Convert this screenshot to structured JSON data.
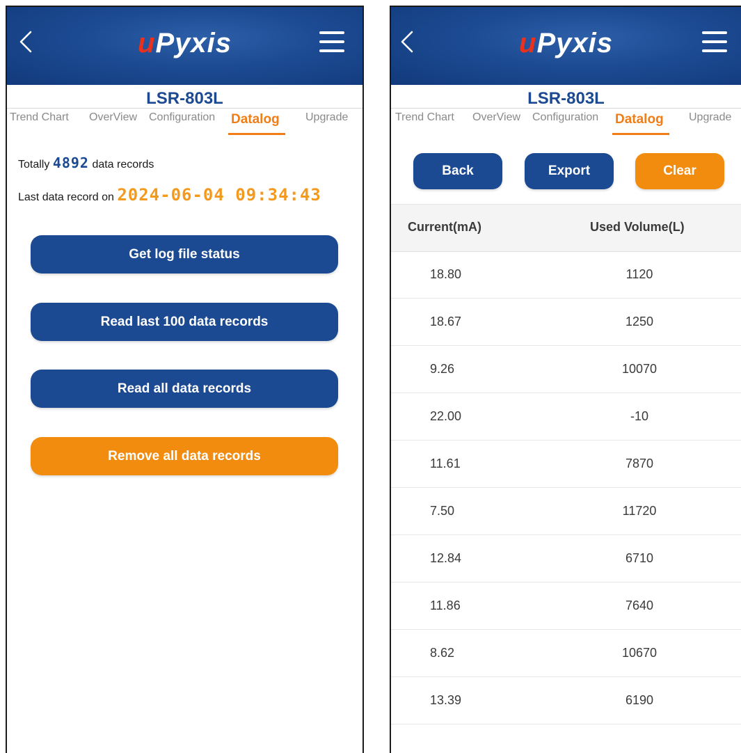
{
  "app": {
    "logo_u": "u",
    "logo_rest": "Pyxis",
    "device_title": "LSR-803L"
  },
  "tabs": [
    "Trend Chart",
    "OverView",
    "Configuration",
    "Datalog",
    "Upgrade"
  ],
  "active_tab": "Datalog",
  "status_screen": {
    "totally_prefix": "Totally",
    "record_count": "4892",
    "totally_suffix": "data records",
    "last_record_prefix": "Last data record on",
    "last_record_datetime": "2024-06-04 09:34:43",
    "buttons": {
      "get_status": "Get log file status",
      "read_last_100": "Read last 100 data records",
      "read_all": "Read all data records",
      "remove_all": "Remove all data records"
    }
  },
  "records_screen": {
    "buttons": {
      "back": "Back",
      "export": "Export",
      "clear": "Clear"
    },
    "columns": [
      "Current(mA)",
      "Used Volume(L)"
    ],
    "rows": [
      {
        "current": "18.80",
        "volume": "1120"
      },
      {
        "current": "18.67",
        "volume": "1250"
      },
      {
        "current": "9.26",
        "volume": "10070"
      },
      {
        "current": "22.00",
        "volume": "-10"
      },
      {
        "current": "11.61",
        "volume": "7870"
      },
      {
        "current": "7.50",
        "volume": "11720"
      },
      {
        "current": "12.84",
        "volume": "6710"
      },
      {
        "current": "11.86",
        "volume": "7640"
      },
      {
        "current": "8.62",
        "volume": "10670"
      },
      {
        "current": "13.39",
        "volume": "6190"
      }
    ]
  },
  "colors": {
    "primary_blue": "#1c4a92",
    "accent_orange": "#f28c0e",
    "logo_red": "#e8321e"
  }
}
